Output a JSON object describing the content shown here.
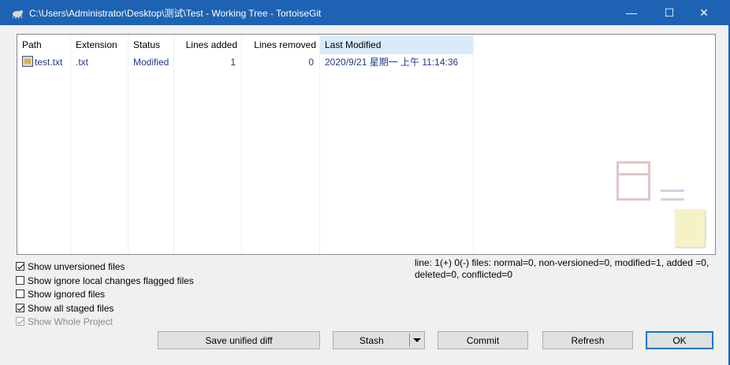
{
  "window": {
    "title": "C:\\Users\\Administrator\\Desktop\\测试\\Test - Working Tree - TortoiseGit",
    "minimize_glyph": "—",
    "maximize_glyph": "☐",
    "close_glyph": "✕",
    "app_icon": "tortoise-icon"
  },
  "file_list": {
    "columns": [
      {
        "label": "Path"
      },
      {
        "label": "Extension"
      },
      {
        "label": "Status"
      },
      {
        "label": "Lines added"
      },
      {
        "label": "Lines removed"
      },
      {
        "label": "Last Modified"
      }
    ],
    "rows": [
      {
        "icon": "text-file-icon",
        "path": "test.txt",
        "extension": ".txt",
        "status": "Modified",
        "lines_added": "1",
        "lines_removed": "0",
        "last_modified": "2020/9/21 星期一 上午 11:14:36"
      }
    ]
  },
  "options": [
    {
      "label": "Show unversioned files",
      "checked": true,
      "enabled": true
    },
    {
      "label": "Show ignore local changes flagged files",
      "checked": false,
      "enabled": true
    },
    {
      "label": "Show ignored files",
      "checked": false,
      "enabled": true
    },
    {
      "label": "Show all staged files",
      "checked": true,
      "enabled": true
    },
    {
      "label": "Show Whole Project",
      "checked": true,
      "enabled": false
    }
  ],
  "stats": "line: 1(+) 0(-) files: normal=0, non-versioned=0, modified=1, added =0, deleted=0, conflicted=0",
  "buttons": {
    "save_unified_diff": "Save unified diff",
    "stash": "Stash",
    "commit": "Commit",
    "refresh": "Refresh",
    "ok": "OK"
  },
  "colors": {
    "titlebar": "#1e63b3",
    "item_text": "#1f3a8f",
    "header_highlight": "#d9ebf9"
  }
}
